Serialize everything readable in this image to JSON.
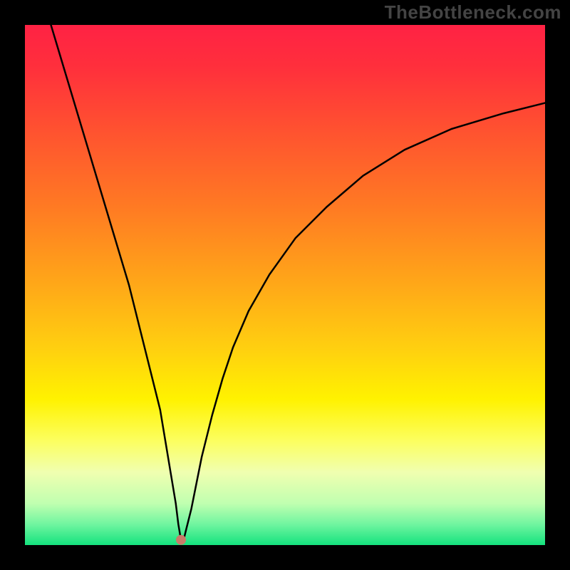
{
  "watermark": "TheBottleneck.com",
  "colors": {
    "black": "#000000",
    "dot": "#c97b69",
    "curve": "#000000",
    "gradient_stops": [
      {
        "offset": 0.0,
        "color": "#ff2244"
      },
      {
        "offset": 0.08,
        "color": "#ff2f3c"
      },
      {
        "offset": 0.2,
        "color": "#ff5130"
      },
      {
        "offset": 0.35,
        "color": "#ff7a23"
      },
      {
        "offset": 0.5,
        "color": "#ffa818"
      },
      {
        "offset": 0.62,
        "color": "#ffcf10"
      },
      {
        "offset": 0.72,
        "color": "#fff200"
      },
      {
        "offset": 0.8,
        "color": "#fcff60"
      },
      {
        "offset": 0.86,
        "color": "#f0ffb0"
      },
      {
        "offset": 0.92,
        "color": "#c0ffb0"
      },
      {
        "offset": 0.96,
        "color": "#70f5a0"
      },
      {
        "offset": 1.0,
        "color": "#14e27e"
      }
    ]
  },
  "chart_data": {
    "type": "line",
    "title": "",
    "xlabel": "",
    "ylabel": "",
    "x_range": [
      0,
      100
    ],
    "y_range": [
      0,
      100
    ],
    "series": [
      {
        "name": "bottleneck-curve",
        "x": [
          5,
          8,
          11,
          14,
          17,
          20,
          22,
          24,
          26,
          27,
          28,
          29,
          29.5,
          30,
          30.5,
          31,
          32,
          33,
          34,
          36,
          38,
          40,
          43,
          47,
          52,
          58,
          65,
          73,
          82,
          92,
          100
        ],
        "y": [
          100,
          90,
          80,
          70,
          60,
          50,
          42,
          34,
          26,
          20,
          14,
          8,
          4,
          1,
          1,
          3,
          7,
          12,
          17,
          25,
          32,
          38,
          45,
          52,
          59,
          65,
          71,
          76,
          80,
          83,
          85
        ]
      }
    ],
    "marker": {
      "x": 30,
      "y": 1,
      "name": "minimum-dot"
    },
    "notes": "Values are visual estimates read off the pixels; plot has no axes, ticks, labels or legend."
  }
}
